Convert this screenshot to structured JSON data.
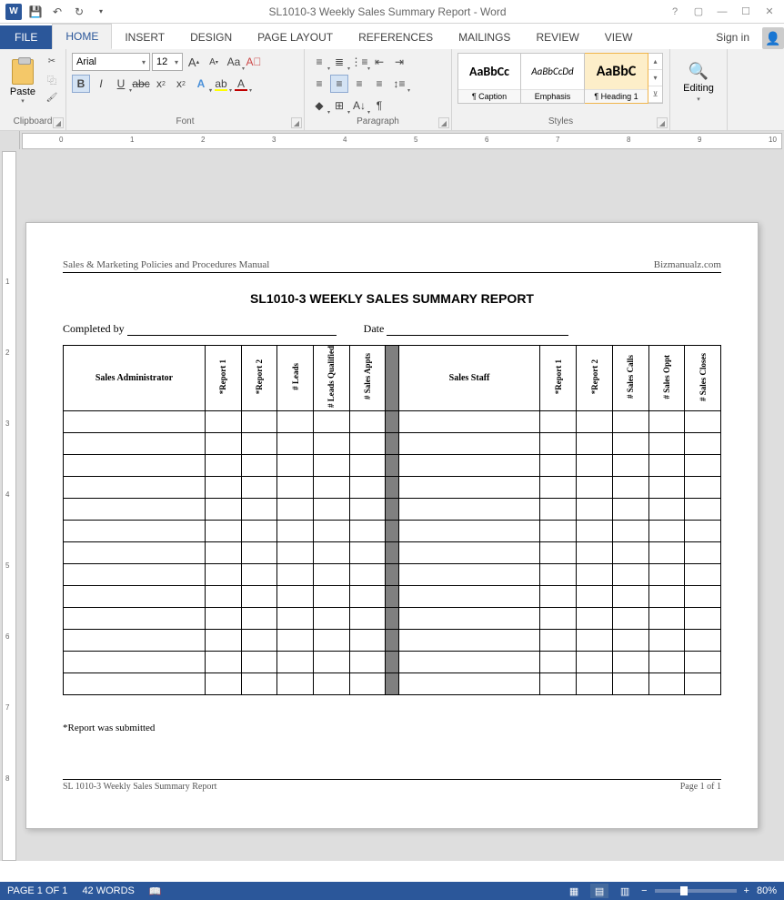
{
  "titlebar": {
    "title": "SL1010-3 Weekly Sales Summary Report - Word"
  },
  "ribbon": {
    "signin": "Sign in",
    "tabs": {
      "file": "FILE",
      "home": "HOME",
      "insert": "INSERT",
      "design": "DESIGN",
      "page_layout": "PAGE LAYOUT",
      "references": "REFERENCES",
      "mailings": "MAILINGS",
      "review": "REVIEW",
      "view": "VIEW"
    },
    "clipboard": {
      "label": "Clipboard",
      "paste": "Paste"
    },
    "font": {
      "label": "Font",
      "name": "Arial",
      "size": "12"
    },
    "paragraph": {
      "label": "Paragraph"
    },
    "styles": {
      "label": "Styles",
      "items": [
        {
          "preview": "AaBbCc",
          "name": "¶ Caption"
        },
        {
          "preview": "AaBbCcDd",
          "name": "Emphasis"
        },
        {
          "preview": "AaBbC",
          "name": "¶ Heading 1"
        }
      ]
    },
    "editing": {
      "label": "Editing"
    }
  },
  "document": {
    "header_left": "Sales & Marketing Policies and Procedures Manual",
    "header_right": "Bizmanualz.com",
    "title": "SL1010-3 WEEKLY SALES SUMMARY REPORT",
    "completed_by": "Completed by",
    "date": "Date",
    "columns_left": [
      "Sales Administrator",
      "*Report 1",
      "*Report 2",
      "# Leads",
      "# Leads Qualified",
      "# Sales Appts"
    ],
    "columns_right": [
      "Sales Staff",
      "*Report 1",
      "*Report 2",
      "# Sales Calls",
      "# Sales Oppt",
      "# Sales Closes"
    ],
    "footnote": "*Report was submitted",
    "footer_left": "SL 1010-3 Weekly Sales Summary Report",
    "footer_right": "Page 1 of 1"
  },
  "statusbar": {
    "page": "PAGE 1 OF 1",
    "words": "42 WORDS",
    "zoom": "80%"
  }
}
